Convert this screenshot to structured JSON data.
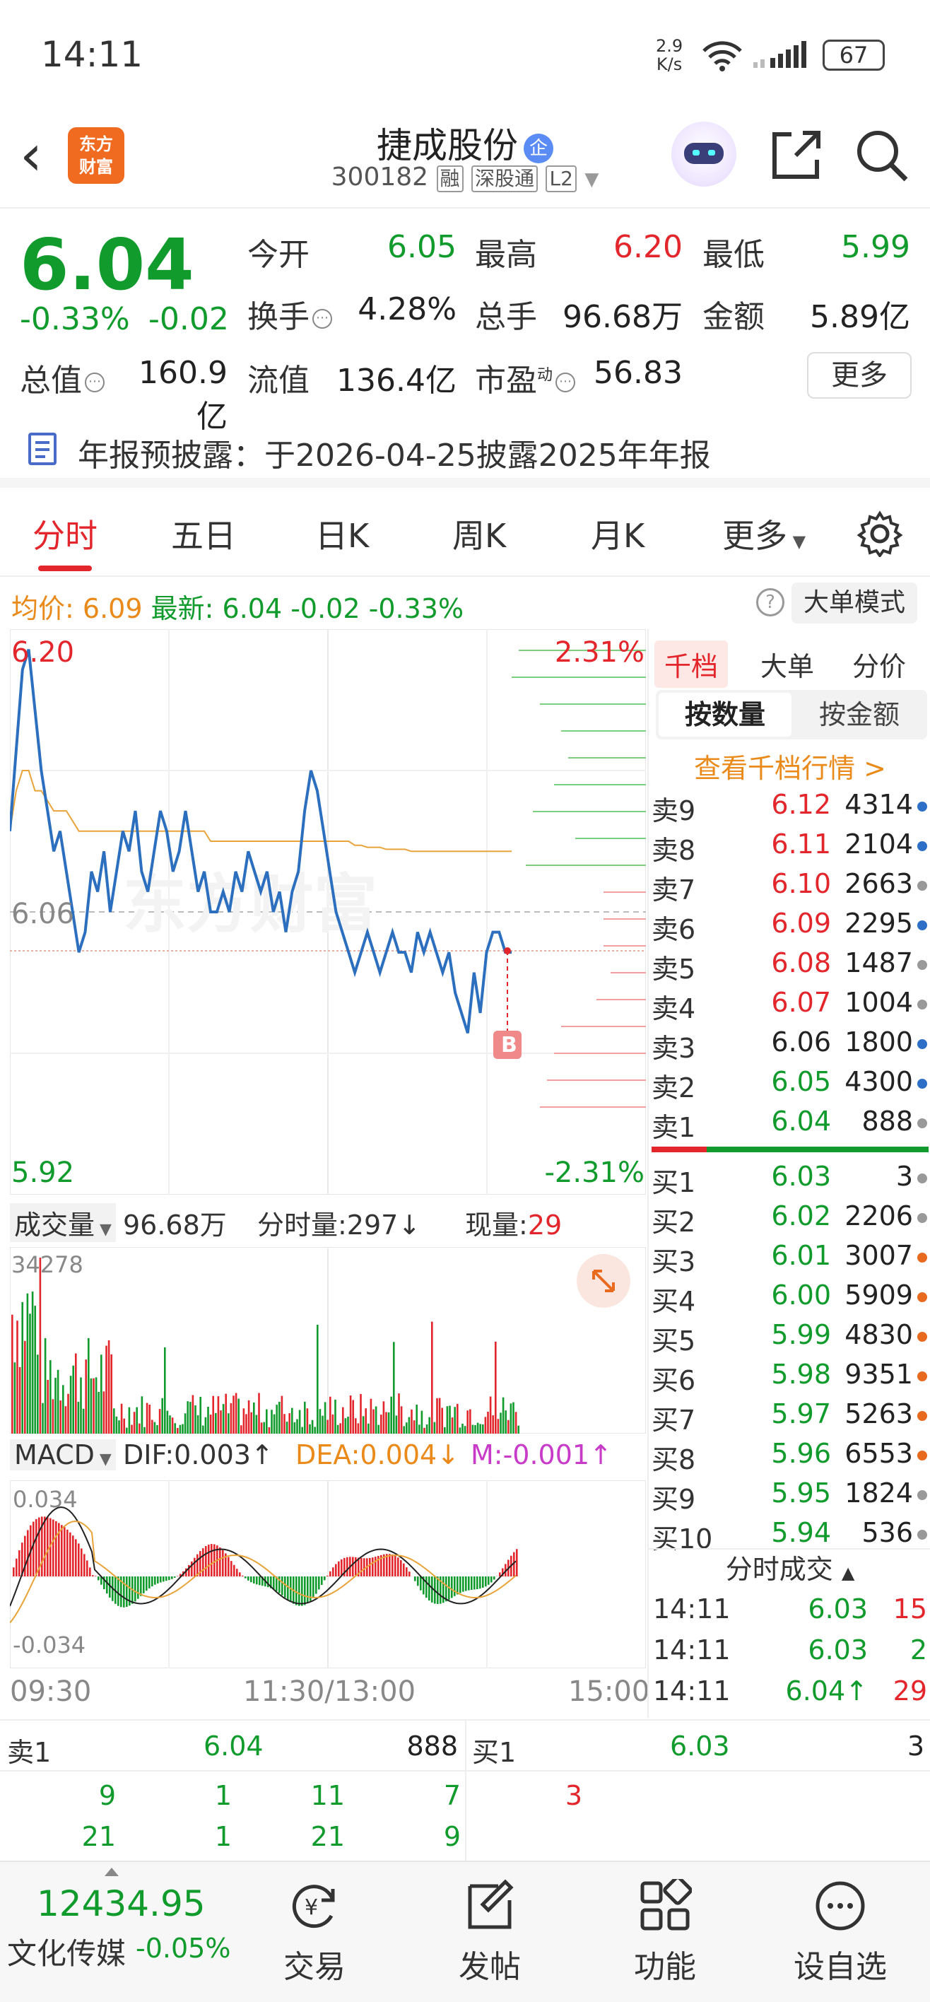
{
  "status": {
    "time": "14:11",
    "net_speed_top": "2.9",
    "net_speed_bottom": "K/s",
    "battery": "67"
  },
  "header": {
    "back_icon": "back-arrow-icon",
    "logo_line1": "东方",
    "logo_line2": "财富",
    "stock_name": "捷成股份",
    "enterprise_badge": "企",
    "stock_code": "300182",
    "tags": [
      "融",
      "深股通",
      "L2"
    ]
  },
  "quote": {
    "price": "6.04",
    "change_pct": "-0.33%",
    "change": "-0.02",
    "stats": [
      {
        "label": "今开",
        "value": "6.05",
        "color": "#109b2c"
      },
      {
        "label": "最高",
        "value": "6.20",
        "color": "#e3262c"
      },
      {
        "label": "最低",
        "value": "5.99",
        "color": "#109b2c"
      },
      {
        "label": "换手",
        "value": "4.28%",
        "color": "#222"
      },
      {
        "label": "总手",
        "value": "96.68万",
        "color": "#222"
      },
      {
        "label": "金额",
        "value": "5.89亿",
        "color": "#222"
      },
      {
        "label": "总值",
        "value": "160.9亿",
        "color": "#222"
      },
      {
        "label": "流值",
        "value": "136.4亿",
        "color": "#222"
      },
      {
        "label": "市盈",
        "value": "56.83",
        "color": "#222"
      }
    ],
    "pe_sup": "动",
    "more_label": "更多"
  },
  "notice": {
    "text": "年报预披露：于2026-04-25披露2025年年报"
  },
  "tabs": [
    "分时",
    "五日",
    "日K",
    "周K",
    "月K",
    "更多"
  ],
  "infoline": {
    "avg_label": "均价:",
    "avg_value": "6.09",
    "latest_label": "最新:",
    "latest_value": "6.04",
    "change": "-0.02",
    "change_pct": "-0.33%",
    "big_order_mode": "大单模式"
  },
  "chart_data": {
    "type": "line",
    "price_axis": {
      "high": "6.20",
      "mid": "6.06",
      "low": "5.92",
      "high_pct": "2.31%",
      "low_pct": "-2.31%"
    },
    "ylim": [
      5.92,
      6.2
    ],
    "time_labels": [
      "09:30",
      "11:30/13:00",
      "15:00"
    ],
    "price_series": [
      6.1,
      6.14,
      6.18,
      6.19,
      6.16,
      6.13,
      6.11,
      6.09,
      6.1,
      6.08,
      6.06,
      6.04,
      6.05,
      6.08,
      6.07,
      6.09,
      6.06,
      6.08,
      6.1,
      6.09,
      6.11,
      6.08,
      6.07,
      6.09,
      6.11,
      6.1,
      6.08,
      6.09,
      6.11,
      6.09,
      6.07,
      6.08,
      6.06,
      6.06,
      6.07,
      6.06,
      6.08,
      6.07,
      6.09,
      6.08,
      6.07,
      6.08,
      6.06,
      6.07,
      6.05,
      6.07,
      6.08,
      6.11,
      6.13,
      6.12,
      6.1,
      6.08,
      6.06,
      6.05,
      6.04,
      6.03,
      6.04,
      6.05,
      6.04,
      6.03,
      6.04,
      6.05,
      6.04,
      6.04,
      6.03,
      6.05,
      6.04,
      6.05,
      6.04,
      6.03,
      6.04,
      6.02,
      6.01,
      6.0,
      6.03,
      6.01,
      6.04,
      6.05,
      6.05,
      6.04,
      6.04
    ],
    "avg_series": [
      6.1,
      6.12,
      6.13,
      6.13,
      6.12,
      6.12,
      6.115,
      6.11,
      6.11,
      6.11,
      6.105,
      6.1,
      6.1,
      6.1,
      6.1,
      6.1,
      6.1,
      6.1,
      6.1,
      6.1,
      6.1,
      6.1,
      6.1,
      6.1,
      6.1,
      6.1,
      6.1,
      6.1,
      6.1,
      6.1,
      6.1,
      6.1,
      6.095,
      6.095,
      6.095,
      6.095,
      6.095,
      6.095,
      6.095,
      6.095,
      6.095,
      6.095,
      6.095,
      6.095,
      6.095,
      6.095,
      6.095,
      6.095,
      6.095,
      6.095,
      6.095,
      6.095,
      6.095,
      6.095,
      6.095,
      6.093,
      6.093,
      6.092,
      6.092,
      6.092,
      6.091,
      6.091,
      6.091,
      6.091,
      6.09,
      6.09,
      6.09,
      6.09,
      6.09,
      6.09,
      6.09,
      6.09,
      6.09,
      6.09,
      6.09,
      6.09,
      6.09,
      6.09,
      6.09,
      6.09,
      6.09
    ],
    "volume_max": "34278",
    "volume_label": "成交量",
    "volume_total": "96.68万",
    "tick_vol_label": "分时量:297",
    "current_vol_label": "现量:",
    "current_vol_value": "29",
    "macd": {
      "label": "MACD",
      "dif": "DIF:0.003",
      "dea": "DEA:0.004",
      "m": "M:-0.001",
      "top": "0.034",
      "bottom": "-0.034"
    },
    "marker": "B"
  },
  "book": {
    "tabs": [
      "千档",
      "大单",
      "分价"
    ],
    "seg": [
      "按数量",
      "按金额"
    ],
    "link": "查看千档行情 >",
    "sells": [
      {
        "l": "卖9",
        "p": "6.12",
        "v": "4314",
        "pc": "#e3262c",
        "dc": "#2d6fc7"
      },
      {
        "l": "卖8",
        "p": "6.11",
        "v": "2104",
        "pc": "#e3262c",
        "dc": "#2d6fc7"
      },
      {
        "l": "卖7",
        "p": "6.10",
        "v": "2663",
        "pc": "#e3262c",
        "dc": "#999999"
      },
      {
        "l": "卖6",
        "p": "6.09",
        "v": "2295",
        "pc": "#e3262c",
        "dc": "#2d6fc7"
      },
      {
        "l": "卖5",
        "p": "6.08",
        "v": "1487",
        "pc": "#e3262c",
        "dc": "#999999"
      },
      {
        "l": "卖4",
        "p": "6.07",
        "v": "1004",
        "pc": "#e3262c",
        "dc": "#999999"
      },
      {
        "l": "卖3",
        "p": "6.06",
        "v": "1800",
        "pc": "#222222",
        "dc": "#2d6fc7"
      },
      {
        "l": "卖2",
        "p": "6.05",
        "v": "4300",
        "pc": "#109b2c",
        "dc": "#2d6fc7"
      },
      {
        "l": "卖1",
        "p": "6.04",
        "v": "888",
        "pc": "#109b2c",
        "dc": "#999999"
      }
    ],
    "buys": [
      {
        "l": "买1",
        "p": "6.03",
        "v": "3",
        "pc": "#109b2c",
        "dc": "#999999"
      },
      {
        "l": "买2",
        "p": "6.02",
        "v": "2206",
        "pc": "#109b2c",
        "dc": "#999999"
      },
      {
        "l": "买3",
        "p": "6.01",
        "v": "3007",
        "pc": "#109b2c",
        "dc": "#e86a1f"
      },
      {
        "l": "买4",
        "p": "6.00",
        "v": "5909",
        "pc": "#109b2c",
        "dc": "#e86a1f"
      },
      {
        "l": "买5",
        "p": "5.99",
        "v": "4830",
        "pc": "#109b2c",
        "dc": "#e86a1f"
      },
      {
        "l": "买6",
        "p": "5.98",
        "v": "9351",
        "pc": "#109b2c",
        "dc": "#e86a1f"
      },
      {
        "l": "买7",
        "p": "5.97",
        "v": "5263",
        "pc": "#109b2c",
        "dc": "#e86a1f"
      },
      {
        "l": "买8",
        "p": "5.96",
        "v": "6553",
        "pc": "#109b2c",
        "dc": "#e86a1f"
      },
      {
        "l": "买9",
        "p": "5.95",
        "v": "1824",
        "pc": "#109b2c",
        "dc": "#999999"
      },
      {
        "l": "买10",
        "p": "5.94",
        "v": "536",
        "pc": "#109b2c",
        "dc": "#999999"
      }
    ],
    "tick_header": "分时成交",
    "ticks": [
      {
        "t": "14:11",
        "p": "6.03",
        "v": "15",
        "vc": "#e3262c"
      },
      {
        "t": "14:11",
        "p": "6.03",
        "v": "2",
        "vc": "#109b2c"
      },
      {
        "t": "14:11",
        "p": "6.04↑",
        "v": "29",
        "vc": "#e3262c"
      }
    ]
  },
  "level": {
    "sell_label": "卖1",
    "sell_price": "6.04",
    "sell_vol": "888",
    "buy_label": "买1",
    "buy_price": "6.03",
    "buy_vol": "3",
    "row1": [
      "9",
      "1",
      "11",
      "7"
    ],
    "row1_right": "3",
    "row2": [
      "21",
      "1",
      "21",
      "9"
    ]
  },
  "bottomnav": {
    "index_value": "12434.95",
    "index_name": "文化传媒",
    "index_change": "-0.05%",
    "items": [
      {
        "label": "交易",
        "icon": "yen-trade-icon"
      },
      {
        "label": "发帖",
        "icon": "edit-post-icon"
      },
      {
        "label": "功能",
        "icon": "grid-function-icon"
      },
      {
        "label": "设自选",
        "icon": "more-dots-icon"
      }
    ]
  }
}
